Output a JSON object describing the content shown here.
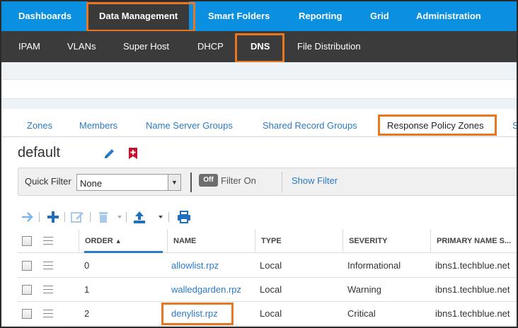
{
  "topnav": {
    "items": [
      "Dashboards",
      "Data Management",
      "Smart Folders",
      "Reporting",
      "Grid",
      "Administration"
    ]
  },
  "subnav": {
    "items": [
      "IPAM",
      "VLANs",
      "Super Host",
      "DHCP",
      "DNS",
      "File Distribution"
    ]
  },
  "tabs": {
    "items": [
      "Zones",
      "Members",
      "Name Server Groups",
      "Shared Record Groups",
      "Response Policy Zones",
      "S"
    ]
  },
  "page": {
    "title": "default"
  },
  "filter": {
    "label": "Quick Filter",
    "value": "None",
    "toggle": "Off",
    "toggle_label": "Filter On",
    "show_filter": "Show Filter"
  },
  "table": {
    "headers": [
      "ORDER",
      "NAME",
      "TYPE",
      "SEVERITY",
      "PRIMARY NAME S..."
    ],
    "rows": [
      {
        "order": "0",
        "name": "allowlist.rpz",
        "type": "Local",
        "severity": "Informational",
        "primary": "ibns1.techblue.net"
      },
      {
        "order": "1",
        "name": "walledgarden.rpz",
        "type": "Local",
        "severity": "Warning",
        "primary": "ibns1.techblue.net"
      },
      {
        "order": "2",
        "name": "denylist.rpz",
        "type": "Local",
        "severity": "Critical",
        "primary": "ibns1.techblue.net"
      }
    ]
  },
  "colors": {
    "topnav_bg": "#0b8fe0",
    "subnav_bg": "#3b3b3b",
    "highlight": "#e87722",
    "link": "#2a7bc6"
  },
  "icons": [
    "pencil-icon",
    "bookmark-add-icon",
    "arrow-right-icon",
    "plus-icon",
    "edit-icon",
    "trash-icon",
    "upload-icon",
    "print-icon",
    "sort-asc-icon",
    "row-menu-icon"
  ]
}
